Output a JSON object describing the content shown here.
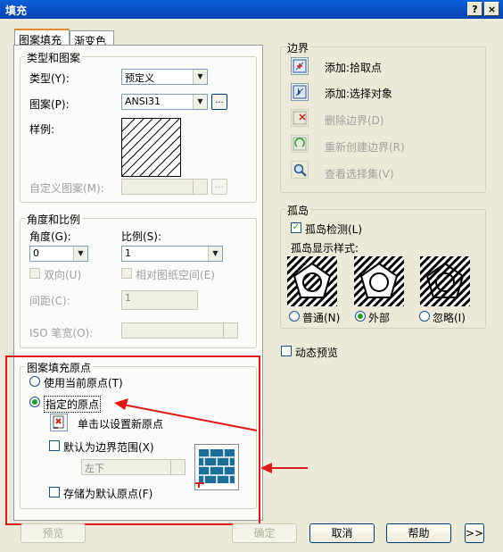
{
  "dialog": {
    "title": "填充",
    "help_btn": "?",
    "close_btn": "×"
  },
  "tabs": [
    {
      "label": "图案填充",
      "active": true
    },
    {
      "label": "渐变色",
      "active": false
    }
  ],
  "type_pattern": {
    "group_title": "类型和图案",
    "type_label": "类型(Y):",
    "type_value": "预定义",
    "pattern_label": "图案(P):",
    "pattern_value": "ANSI31",
    "browse_btn": "...",
    "swatch_label": "样例:",
    "custom_label": "自定义图案(M):",
    "custom_btn": "..."
  },
  "angle_scale": {
    "group_title": "角度和比例",
    "angle_label": "角度(G):",
    "angle_value": "0",
    "scale_label": "比例(S):",
    "scale_value": "1",
    "double_label": "双向(U)",
    "relative_label": "相对图纸空间(E)",
    "spacing_label": "间距(C):",
    "spacing_value": "1",
    "iso_label": "ISO 笔宽(O):"
  },
  "origin": {
    "group_title": "图案填充原点",
    "use_current_label": "使用当前原点(T)",
    "specified_label": "指定的原点",
    "click_set_label": "单击以设置新原点",
    "default_extents_label": "默认为边界范围(X)",
    "extents_value": "左下",
    "store_default_label": "存储为默认原点(F)"
  },
  "boundary": {
    "group_title": "边界",
    "items": [
      {
        "label": "添加:拾取点",
        "icon": "pick-point-icon",
        "enabled": true
      },
      {
        "label": "添加:选择对象",
        "icon": "select-objects-icon",
        "enabled": true
      },
      {
        "label": "删除边界(D)",
        "icon": "remove-boundary-icon",
        "enabled": false
      },
      {
        "label": "重新创建边界(R)",
        "icon": "recreate-boundary-icon",
        "enabled": false
      },
      {
        "label": "查看选择集(V)",
        "icon": "view-selection-icon",
        "enabled": false
      }
    ]
  },
  "islands": {
    "group_title": "孤岛",
    "detect_label": "孤岛检测(L)",
    "style_label": "孤岛显示样式:",
    "styles": [
      {
        "label": "普通(N)",
        "selected": false
      },
      {
        "label": "外部",
        "selected": true
      },
      {
        "label": "忽略(I)",
        "selected": false
      }
    ]
  },
  "preview_dynamic_label": "动态预览",
  "footer": {
    "preview_btn": "预览",
    "ok_btn": "确定",
    "cancel_btn": "取消",
    "help_btn": "帮助",
    "more_btn": ">>"
  },
  "colors": {
    "title_bar": "#0a5fd8",
    "annotation_red": "#e01818",
    "accent_green": "#21a121"
  }
}
